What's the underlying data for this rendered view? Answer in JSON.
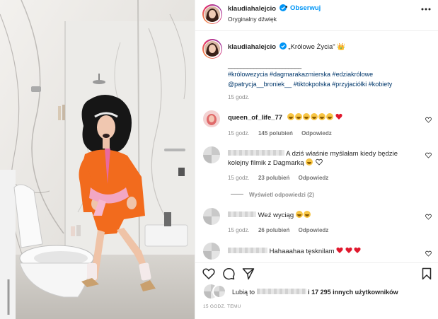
{
  "header": {
    "username": "klaudiahalejcio",
    "separator": "•",
    "follow_label": "Obserwuj",
    "audio_label": "Oryginalny dźwięk"
  },
  "caption": {
    "username": "klaudiahalejcio",
    "text": "„Królowe Życia\" 👑",
    "divider_line": "_______________________",
    "hashtags_line1": "#królowezycia #dagmarakazmierska #edziakrólowe",
    "hashtags_line2": "@patrycja__broniek__ #tiktokpolska #przyjaciółki #kobiety",
    "time": "15 godz."
  },
  "comments": [
    {
      "username": "queen_of_life_77",
      "time": "15 godz.",
      "likes": "145 polubień",
      "reply": "Odpowiedz"
    },
    {
      "text_line1": "A dziś właśnie myślałam kiedy będzie",
      "text_line2": "kolejny filmik z Dagmarką",
      "time": "15 godz.",
      "likes": "23 polubień",
      "reply": "Odpowiedz",
      "view_replies": "Wyświetl odpowiedzi (2)"
    },
    {
      "text": "Weź wyciąg",
      "time": "15 godz.",
      "likes": "26 polubień",
      "reply": "Odpowiedz"
    },
    {
      "text": "Hahaaahaa tęsknilam"
    }
  ],
  "likes_summary": {
    "prefix": "Lubią to",
    "and_text": "i 17 295 innych użytkowników"
  },
  "post_time": "15 GODZ. TEMU",
  "colors": {
    "accent": "#0095f6",
    "hashtag": "#00376b",
    "muted": "#8e8e8e",
    "heart": "#ed4956",
    "blazer": "#f26b1d"
  },
  "icons": [
    "verified-badge-icon",
    "more-options-icon",
    "heart-icon",
    "comment-icon",
    "share-icon",
    "bookmark-icon",
    "crown-icon"
  ]
}
